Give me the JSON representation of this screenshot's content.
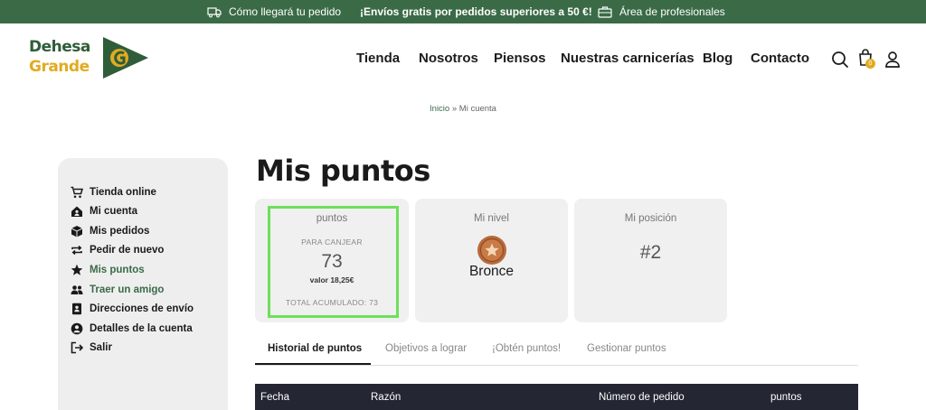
{
  "topbar": {
    "shipping_info": "Cómo llegará tu pedido",
    "free_shipping": "¡Envíos gratis por pedidos superiores a 50 €!",
    "professionals": "Área de profesionales",
    "background": "#3a6b46"
  },
  "logo": {
    "line1": "Dehesa",
    "line2": "Grande",
    "badge_letter": "G"
  },
  "nav": {
    "items": [
      "Tienda",
      "Nosotros",
      "Piensos",
      "Nuestras carnicerías",
      "Blog",
      "Contacto"
    ]
  },
  "header_icons": [
    "search-icon",
    "cart-icon",
    "user-icon"
  ],
  "cart_badge": "0",
  "breadcrumb": {
    "home": "Inicio",
    "separator": "»",
    "current": "Mi cuenta"
  },
  "sidebar": {
    "items": [
      {
        "label": "Tienda online",
        "icon": "cart-icon"
      },
      {
        "label": "Mi cuenta",
        "icon": "house-user-icon"
      },
      {
        "label": "Mis pedidos",
        "icon": "box-icon"
      },
      {
        "label": "Pedir de nuevo",
        "icon": "repeat-icon"
      },
      {
        "label": "Mis puntos",
        "icon": "star-icon",
        "active": true
      },
      {
        "label": "Traer un amigo",
        "icon": "users-icon"
      },
      {
        "label": "Direcciones de envío",
        "icon": "address-book-icon"
      },
      {
        "label": "Detalles de la cuenta",
        "icon": "user-circle-icon"
      },
      {
        "label": "Salir",
        "icon": "logout-icon"
      }
    ]
  },
  "main": {
    "title": "Mis puntos",
    "points_card": {
      "title": "puntos",
      "redeem_label": "PARA CANJEAR",
      "points": "73",
      "value": "valor 18,25€",
      "total": "TOTAL ACUMULADO: 73"
    },
    "level_card": {
      "title": "Mi nivel",
      "level": "Bronce"
    },
    "position_card": {
      "title": "Mi posición",
      "position": "#2"
    },
    "tabs": [
      "Historial de puntos",
      "Objetivos a lograr",
      "¡Obtén puntos!",
      "Gestionar puntos"
    ],
    "table_headers": [
      "Fecha",
      "Razón",
      "Número de pedido",
      "puntos"
    ]
  },
  "colors": {
    "accent": "#3a6b46",
    "highlight": "#6de05a",
    "table_header": "#242733",
    "gold": "#e2ab20"
  }
}
